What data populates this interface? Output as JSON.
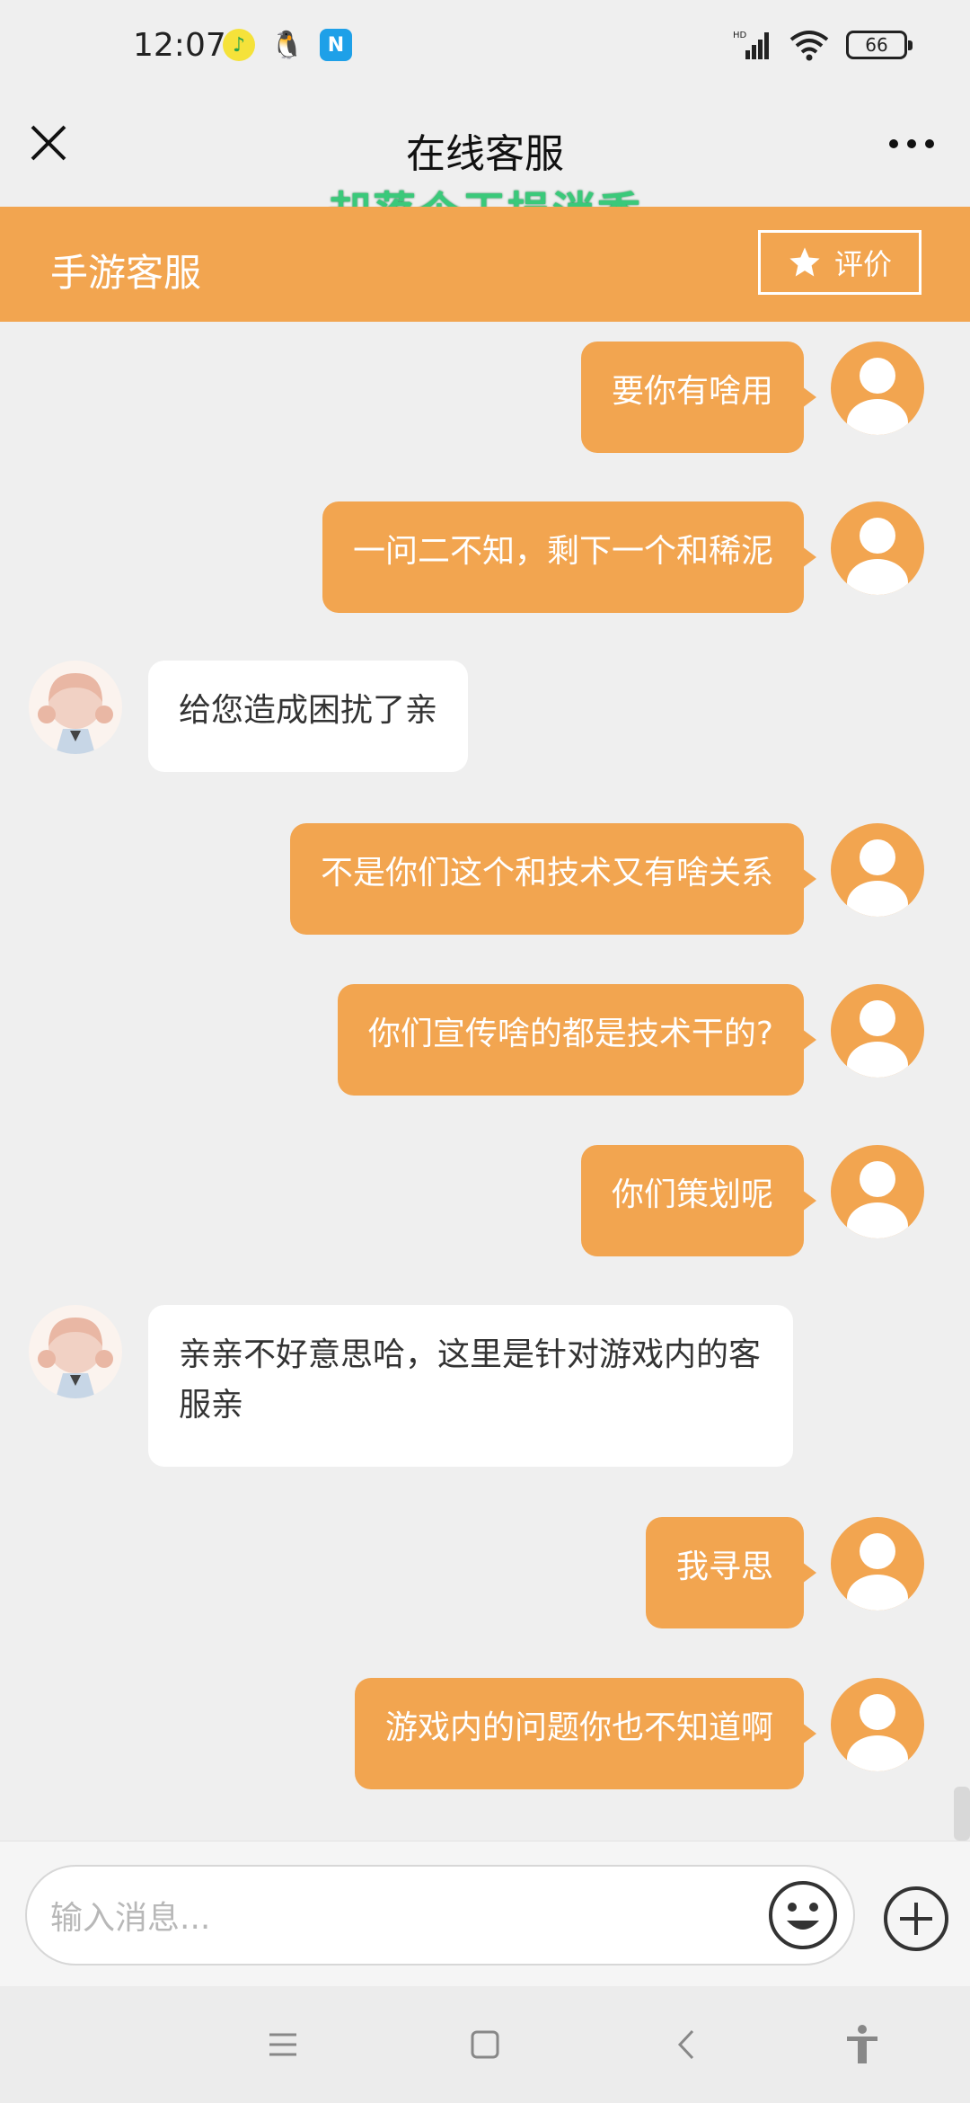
{
  "status_bar": {
    "time": "12:07",
    "network": "HD",
    "battery": "66"
  },
  "title_bar": {
    "title": "在线客服",
    "watermark": "却落个玉损消香"
  },
  "service_header": {
    "name": "手游客服",
    "rate_label": "评价"
  },
  "messages": [
    {
      "from": "user",
      "text": "要你有啥用"
    },
    {
      "from": "user",
      "text": "一问二不知，剩下一个和稀泥"
    },
    {
      "from": "agent",
      "text": "给您造成困扰了亲"
    },
    {
      "from": "user",
      "text": "不是你们这个和技术又有啥关系"
    },
    {
      "from": "user",
      "text": "你们宣传啥的都是技术干的?"
    },
    {
      "from": "user",
      "text": "你们策划呢"
    },
    {
      "from": "agent",
      "text": "亲亲不好意思哈，这里是针对游戏内的客服亲"
    },
    {
      "from": "user",
      "text": "我寻思"
    },
    {
      "from": "user",
      "text": "游戏内的问题你也不知道啊"
    }
  ],
  "input": {
    "placeholder": "输入消息..."
  },
  "colors": {
    "accent": "#f2a550",
    "background": "#efefef",
    "watermark": "#3ac97a"
  }
}
